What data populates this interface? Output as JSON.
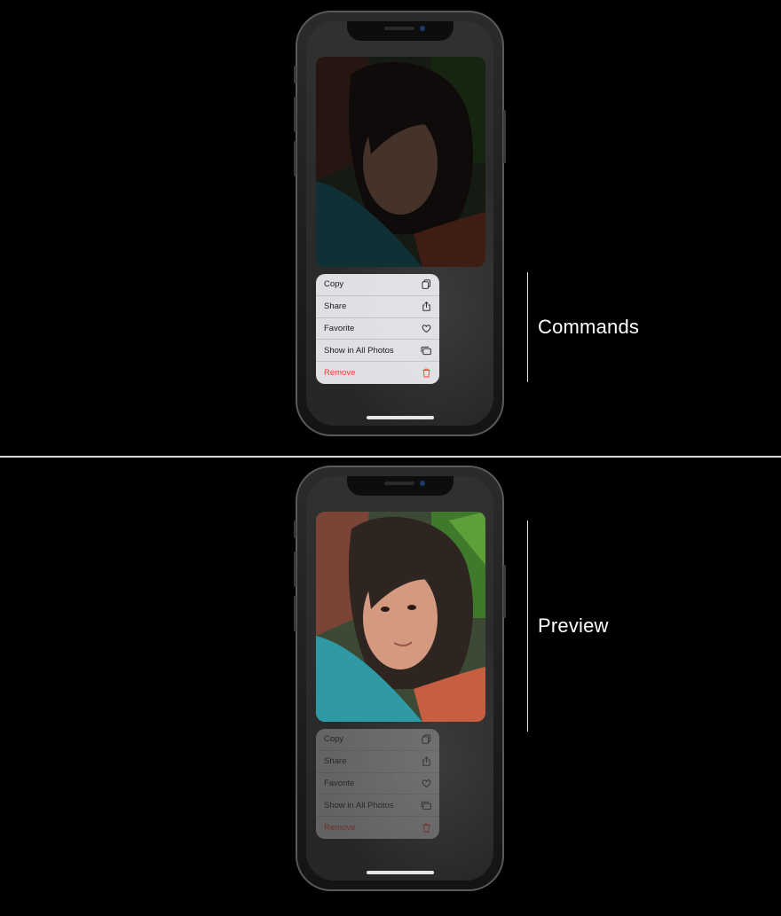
{
  "menu": {
    "items": [
      {
        "label": "Copy",
        "icon": "copy-icon"
      },
      {
        "label": "Share",
        "icon": "share-icon"
      },
      {
        "label": "Favorite",
        "icon": "heart-icon"
      },
      {
        "label": "Show in All Photos",
        "icon": "photos-stack-icon"
      },
      {
        "label": "Remove",
        "icon": "trash-icon"
      }
    ],
    "destructive_color": "#ff3b30"
  },
  "annotations": {
    "commands": "Commands",
    "preview": "Preview"
  }
}
